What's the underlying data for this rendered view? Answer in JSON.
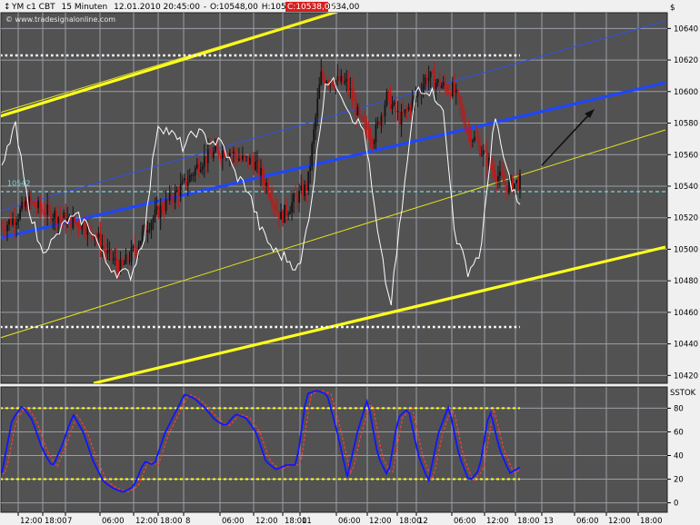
{
  "header": {
    "symbol": "YM c1 CBT",
    "timeframe": "15 Minuten",
    "datetime": "12.01.2010 20:45:00",
    "open": "O:10548,00",
    "high": "H:10550,00",
    "low": "L:10534,00",
    "close": "C:10538,00",
    "watermark": "© www.tradesignalonline.com",
    "currency": "$"
  },
  "colors": {
    "panel_bg": "#525252",
    "grid": "#9a9ea6",
    "close_label_bg": "#d81e1e",
    "channel_outer": "#ffff1e",
    "channel_inner": "#e3e31e",
    "regression": "#1e46ff",
    "regression_thin": "#3250e6",
    "cyan_level": "#7ad8d8",
    "oscillator_main": "#1414ff",
    "oscillator_signal": "#ff3c3c",
    "arrow": "#101010"
  },
  "chart_data": [
    {
      "type": "candlestick",
      "instrument": "YM c1 CBT",
      "interval": "15 Minuten",
      "ylim": [
        10415,
        10650
      ],
      "y_ticks": [
        10420,
        10440,
        10460,
        10480,
        10500,
        10520,
        10540,
        10560,
        10580,
        10600,
        10620,
        10640
      ],
      "x_ticks": [
        "12:00",
        "18:00",
        "7",
        "06:00",
        "12:00",
        "18:00",
        "8",
        "06:00",
        "12:00",
        "18:00",
        "11",
        "06:00",
        "12:00",
        "18:00",
        "12",
        "06:00",
        "12:00",
        "18:00",
        "13",
        "06:00",
        "12:00",
        "18:00"
      ],
      "levels": {
        "resistance": 10623,
        "support": 10451,
        "cyan": 10538,
        "cyan_label": "10542"
      },
      "close_series": [
        10514,
        10520,
        10530,
        10525,
        10522,
        10518,
        10516,
        10510,
        10496,
        10488,
        10500,
        10516,
        10526,
        10534,
        10544,
        10556,
        10561,
        10563,
        10557,
        10555,
        10540,
        10520,
        10531,
        10540,
        10610,
        10607,
        10605,
        10580,
        10571,
        10597,
        10582,
        10594,
        10610,
        10604,
        10601,
        10577,
        10564,
        10550,
        10540,
        10543
      ],
      "overlay_series": [
        10550,
        10580,
        10530,
        10500,
        10505,
        10518,
        10520,
        10512,
        10492,
        10485,
        10484,
        10509,
        10580,
        10574,
        10565,
        10575,
        10569,
        10567,
        10548,
        10538,
        10512,
        10499,
        10494,
        10487,
        10537,
        10608,
        10603,
        10585,
        10575,
        10510,
        10463,
        10534,
        10603,
        10601,
        10592,
        10509,
        10486,
        10499,
        10584,
        10549,
        10526
      ]
    },
    {
      "type": "line",
      "title": "SSTOK",
      "ylim": [
        -8,
        98
      ],
      "y_ticks": [
        0,
        20,
        40,
        60,
        80
      ],
      "levels": [
        80,
        20
      ],
      "series": [
        {
          "values": [
            25,
            70,
            82,
            70,
            45,
            30,
            50,
            75,
            60,
            35,
            18,
            12,
            9,
            14,
            35,
            32,
            58,
            75,
            92,
            88,
            80,
            70,
            65,
            75,
            72,
            60,
            35,
            28,
            32,
            32,
            92,
            95,
            92,
            60,
            22,
            60,
            88,
            40,
            22,
            72,
            80,
            40,
            18,
            60,
            82,
            40,
            18,
            28,
            80,
            45,
            25,
            30
          ]
        }
      ]
    }
  ],
  "annotations": {
    "arrow_up": "trend-arrow"
  }
}
